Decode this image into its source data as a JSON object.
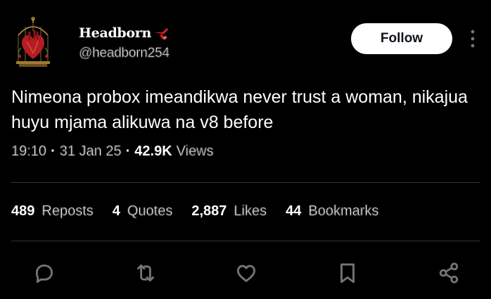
{
  "author": {
    "display_name": "Headborn",
    "handle": "@headborn254",
    "avatar_icon": "anatomical-heart-birdcage-icon",
    "name_emoji_icon": "red-scalpel-emoji-icon"
  },
  "follow_button": {
    "label": "Follow"
  },
  "tweet": {
    "text": "Nimeona probox imeandikwa never trust a woman, nikajua huyu mjama alikuwa na v8 before",
    "time": "19:10",
    "date": "31 Jan 25",
    "views_count": "42.9K",
    "views_label": "Views",
    "separator": "·"
  },
  "stats": {
    "reposts": {
      "count": "489",
      "label": "Reposts"
    },
    "quotes": {
      "count": "4",
      "label": "Quotes"
    },
    "likes": {
      "count": "2,887",
      "label": "Likes"
    },
    "bookmarks": {
      "count": "44",
      "label": "Bookmarks"
    }
  },
  "actions": [
    "reply-icon",
    "repost-icon",
    "like-icon",
    "bookmark-icon",
    "share-icon"
  ],
  "colors": {
    "background": "#000000",
    "text": "#e7e9ea",
    "muted_icon": "#71767b",
    "divider": "#2f3336",
    "accent_red": "#e0242a"
  }
}
